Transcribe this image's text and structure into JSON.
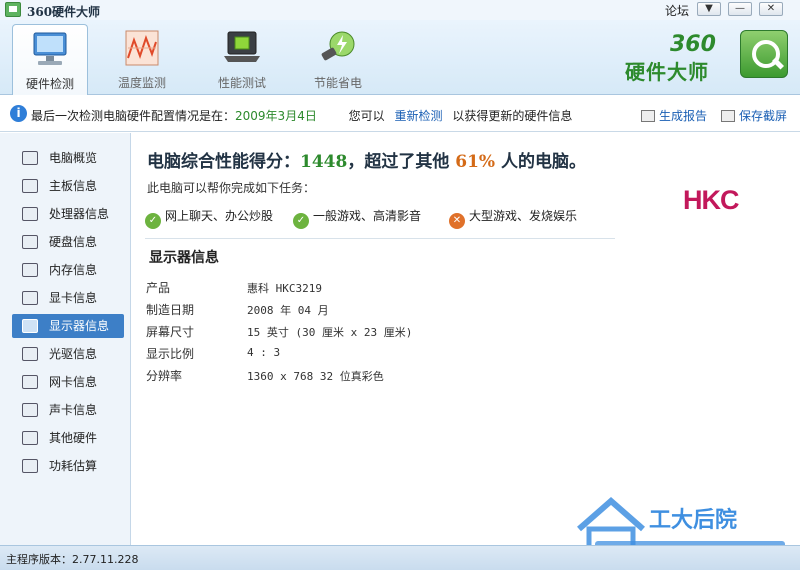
{
  "window": {
    "title": "360硬件大师",
    "forum_link": "论坛",
    "menu_glyph": "▼",
    "minimize_glyph": "—",
    "close_glyph": "✕"
  },
  "toolbar": {
    "tabs": [
      {
        "label": "硬件检测",
        "icon": "monitor-icon",
        "active": true
      },
      {
        "label": "温度监测",
        "icon": "temperature-chart-icon",
        "active": false
      },
      {
        "label": "性能测试",
        "icon": "laptop-chip-icon",
        "active": false
      },
      {
        "label": "节能省电",
        "icon": "energy-saving-icon",
        "active": false
      }
    ],
    "brand": {
      "number": "360",
      "name": "硬件大师"
    }
  },
  "infobar": {
    "prefix": "最后一次检测电脑硬件配置情况是在：",
    "date": "2009年3月4日",
    "you_can": "您可以",
    "redetect_link": "重新检测",
    "suffix": "以获得更新的硬件信息",
    "report_link": "生成报告",
    "screenshot_link": "保存截屏"
  },
  "sidebar": {
    "items": [
      {
        "label": "电脑概览",
        "icon": "computer-icon"
      },
      {
        "label": "主板信息",
        "icon": "motherboard-icon"
      },
      {
        "label": "处理器信息",
        "icon": "cpu-icon"
      },
      {
        "label": "硬盘信息",
        "icon": "hard-disk-icon"
      },
      {
        "label": "内存信息",
        "icon": "memory-icon"
      },
      {
        "label": "显卡信息",
        "icon": "graphics-card-icon"
      },
      {
        "label": "显示器信息",
        "icon": "display-icon",
        "active": true
      },
      {
        "label": "光驱信息",
        "icon": "optical-drive-icon"
      },
      {
        "label": "网卡信息",
        "icon": "network-card-icon"
      },
      {
        "label": "声卡信息",
        "icon": "sound-card-icon"
      },
      {
        "label": "其他硬件",
        "icon": "other-hardware-icon"
      },
      {
        "label": "功耗估算",
        "icon": "power-icon"
      }
    ]
  },
  "main": {
    "score_prefix": "电脑综合性能得分：",
    "score_value": "1448",
    "score_middle": "，超过了其他 ",
    "score_percent": "61%",
    "score_suffix": " 人的电脑。",
    "tasks_caption": "此电脑可以帮你完成如下任务：",
    "tasks": [
      {
        "label": "网上聊天、办公炒股",
        "status": "ok"
      },
      {
        "label": "一般游戏、高清影音",
        "status": "ok"
      },
      {
        "label": "大型游戏、发烧娱乐",
        "status": "no"
      }
    ],
    "brand_logo": "HKC",
    "section_title": "显示器信息",
    "properties": [
      {
        "label": "产品",
        "value": "惠科 HKC3219"
      },
      {
        "label": "制造日期",
        "value": "2008 年 04 月"
      },
      {
        "label": "屏幕尺寸",
        "value": "15 英寸 (30 厘米 x 23 厘米)"
      },
      {
        "label": "显示比例",
        "value": "4 : 3"
      },
      {
        "label": "分辨率",
        "value": "1360 x 768 32 位真彩色"
      }
    ]
  },
  "watermark": {
    "text": "工大后院"
  },
  "statusbar": {
    "version_text": "主程序版本：2.77.11.228"
  },
  "colors": {
    "accent_green": "#2d8a2d",
    "accent_orange": "#d46a17",
    "selection_blue": "#3d7fc7",
    "hkc_pink": "#c2185b"
  }
}
